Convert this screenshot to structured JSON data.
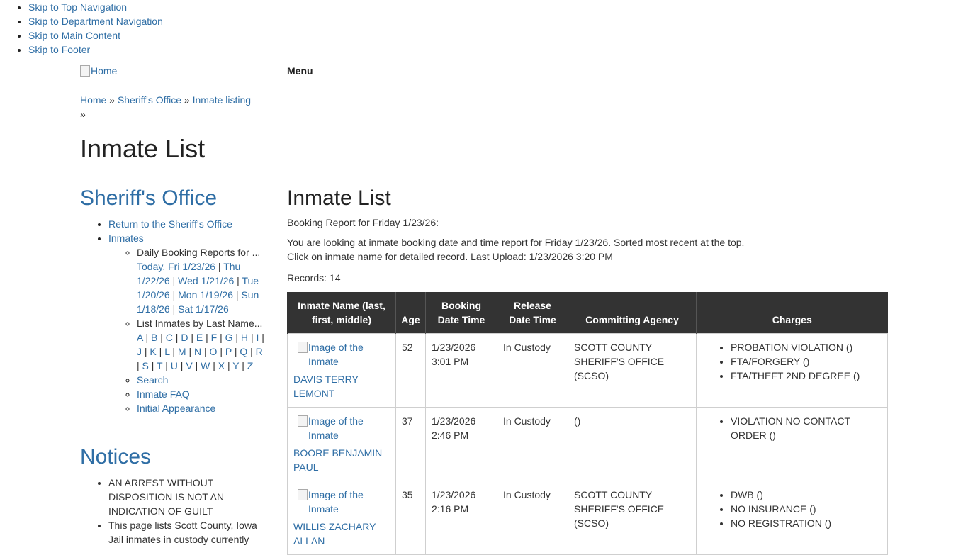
{
  "skip_links": [
    "Skip to Top Navigation",
    "Skip to Department Navigation",
    "Skip to Main Content",
    "Skip to Footer"
  ],
  "header": {
    "logo_alt": "Home",
    "menu_label": "Menu"
  },
  "breadcrumb": {
    "items": [
      "Home",
      "Sheriff's Office",
      "Inmate listing"
    ],
    "separator": "»"
  },
  "page_title": "Inmate List",
  "sidebar": {
    "title": "Sheriff's Office",
    "return_link": "Return to the Sheriff's Office",
    "inmates_link": "Inmates",
    "daily_reports_label": "Daily Booking Reports for ...",
    "daily_reports": [
      "Today, Fri 1/23/26",
      "Thu 1/22/26",
      "Wed 1/21/26",
      "Tue 1/20/26",
      "Mon 1/19/26",
      "Sun 1/18/26",
      "Sat 1/17/26"
    ],
    "last_name_label": "List Inmates by Last Name...",
    "letters": [
      "A",
      "B",
      "C",
      "D",
      "E",
      "F",
      "G",
      "H",
      "I",
      "J",
      "K",
      "L",
      "M",
      "N",
      "O",
      "P",
      "Q",
      "R",
      "S",
      "T",
      "U",
      "V",
      "W",
      "X",
      "Y",
      "Z"
    ],
    "search_link": "Search",
    "faq_link": "Inmate FAQ",
    "initial_appearance_link": "Initial Appearance",
    "separator": "|"
  },
  "notices": {
    "title": "Notices",
    "items": [
      "AN ARREST WITHOUT DISPOSITION IS NOT AN INDICATION OF GUILT",
      "This page lists Scott County, Iowa Jail inmates in custody currently"
    ]
  },
  "main": {
    "title": "Inmate List",
    "report_heading": "Booking Report for Friday 1/23/26:",
    "intro_line1": "You are looking at inmate booking date and time report for Friday 1/23/26. Sorted most recent at the top.",
    "intro_line2": "Click on inmate name for detailed record. Last Upload: 1/23/2026 3:20 PM",
    "records": "Records: 14"
  },
  "table": {
    "headers": [
      "Inmate Name (last, first, middle)",
      "Age",
      "Booking Date Time",
      "Release Date Time",
      "Committing Agency",
      "Charges"
    ],
    "image_alt": "Image of the Inmate",
    "rows": [
      {
        "name": "DAVIS TERRY LEMONT",
        "age": "52",
        "booking": "1/23/2026 3:01 PM",
        "release": "In Custody",
        "agency": "SCOTT COUNTY SHERIFF'S OFFICE (SCSO)",
        "charges": [
          "PROBATION VIOLATION ()",
          "FTA/FORGERY ()",
          "FTA/THEFT 2ND DEGREE ()"
        ]
      },
      {
        "name": "BOORE BENJAMIN PAUL",
        "age": "37",
        "booking": "1/23/2026 2:46 PM",
        "release": "In Custody",
        "agency": "()",
        "charges": [
          "VIOLATION NO CONTACT ORDER ()"
        ]
      },
      {
        "name": "WILLIS ZACHARY ALLAN",
        "age": "35",
        "booking": "1/23/2026 2:16 PM",
        "release": "In Custody",
        "agency": "SCOTT COUNTY SHERIFF'S OFFICE (SCSO)",
        "charges": [
          "DWB ()",
          "NO INSURANCE ()",
          "NO REGISTRATION ()"
        ]
      }
    ]
  }
}
